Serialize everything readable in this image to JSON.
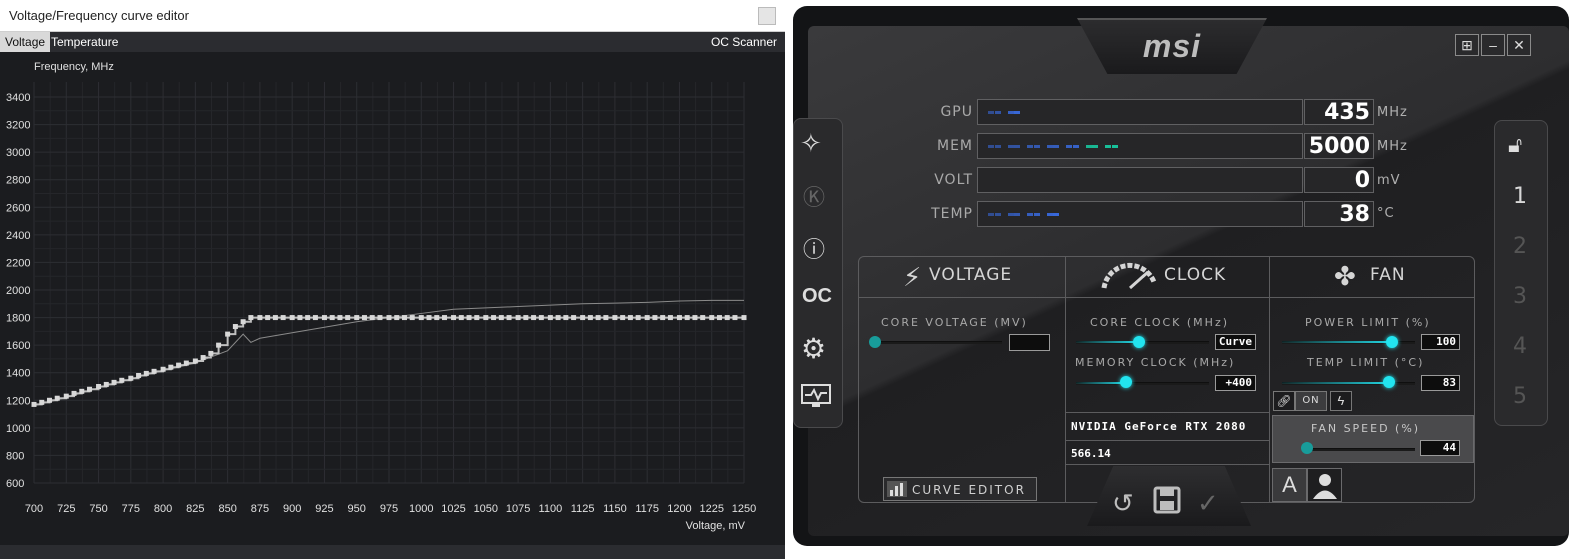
{
  "curve_editor": {
    "title": "Voltage/Frequency curve editor",
    "tabs": [
      "Voltage",
      "Temperature"
    ],
    "oc_scanner": "OC Scanner",
    "chart_data": {
      "type": "line",
      "ylabel": "Frequency, MHz",
      "xlabel": "Voltage, mV",
      "xlim": [
        700,
        1250
      ],
      "ylim": [
        600,
        3400
      ],
      "x_ticks": [
        700,
        725,
        750,
        775,
        800,
        825,
        850,
        875,
        900,
        925,
        950,
        975,
        1000,
        1025,
        1050,
        1075,
        1100,
        1125,
        1150,
        1175,
        1200,
        1225,
        1250
      ],
      "y_ticks": [
        600,
        800,
        1000,
        1200,
        1400,
        1600,
        1800,
        2000,
        2200,
        2400,
        2600,
        2800,
        3000,
        3200,
        3400
      ],
      "grid": true,
      "series": [
        {
          "x": [
            700,
            706,
            712,
            718,
            725,
            731,
            737,
            743,
            750,
            756,
            762,
            768,
            775,
            781,
            787,
            793,
            800,
            806,
            812,
            818,
            825,
            831,
            837,
            843,
            850,
            856,
            862,
            868,
            875,
            881,
            887,
            893,
            900,
            906,
            912,
            918,
            925,
            931,
            937,
            943,
            950,
            956,
            962,
            968,
            975,
            981,
            987,
            993,
            1000,
            1006,
            1012,
            1018,
            1025,
            1031,
            1037,
            1043,
            1050,
            1056,
            1062,
            1068,
            1075,
            1081,
            1087,
            1093,
            1100,
            1106,
            1112,
            1118,
            1125,
            1131,
            1137,
            1143,
            1150,
            1156,
            1162,
            1168,
            1175,
            1181,
            1187,
            1193,
            1200,
            1206,
            1212,
            1218,
            1225,
            1231,
            1237,
            1243,
            1250
          ],
          "y": [
            1170,
            1185,
            1200,
            1215,
            1230,
            1250,
            1265,
            1280,
            1300,
            1315,
            1330,
            1345,
            1360,
            1380,
            1395,
            1410,
            1425,
            1440,
            1455,
            1470,
            1485,
            1510,
            1540,
            1600,
            1680,
            1735,
            1770,
            1800,
            1800,
            1800,
            1800,
            1800,
            1800,
            1800,
            1800,
            1800,
            1800,
            1800,
            1800,
            1800,
            1800,
            1800,
            1800,
            1800,
            1800,
            1800,
            1800,
            1800,
            1800,
            1800,
            1800,
            1800,
            1800,
            1800,
            1800,
            1800,
            1800,
            1800,
            1800,
            1800,
            1800,
            1800,
            1800,
            1800,
            1800,
            1800,
            1800,
            1800,
            1800,
            1800,
            1800,
            1800,
            1800,
            1800,
            1800,
            1800,
            1800,
            1800,
            1800,
            1800,
            1800,
            1800,
            1800,
            1800,
            1800,
            1800,
            1800,
            1800,
            1800
          ]
        },
        {
          "x": [
            700,
            725,
            750,
            775,
            800,
            825,
            850,
            862,
            868,
            875,
            900,
            925,
            950,
            975,
            1000,
            1025,
            1050,
            1075,
            1100,
            1125,
            1150,
            1175,
            1200,
            1225,
            1250
          ],
          "y": [
            1160,
            1220,
            1290,
            1355,
            1415,
            1470,
            1560,
            1680,
            1620,
            1650,
            1690,
            1730,
            1770,
            1800,
            1830,
            1860,
            1870,
            1880,
            1890,
            1900,
            1905,
            1910,
            1920,
            1925,
            1925
          ]
        }
      ]
    }
  },
  "afterburner": {
    "brand": "msi",
    "monitor": [
      {
        "label": "GPU",
        "value": "435",
        "unit": "MHz",
        "fill": 0.17
      },
      {
        "label": "MEM",
        "value": "5000",
        "unit": "MHz",
        "fill": 0.65
      },
      {
        "label": "VOLT",
        "value": "0",
        "unit": "mV",
        "fill": 0
      },
      {
        "label": "TEMP",
        "value": "38",
        "unit": "°C",
        "fill": 0.38
      }
    ],
    "sections": {
      "voltage": "VOLTAGE",
      "clock": "CLOCK",
      "fan": "FAN"
    },
    "core_voltage": {
      "label": "CORE VOLTAGE  (MV)",
      "value": ""
    },
    "core_clock": {
      "label": "CORE CLOCK (MHz)",
      "value": "Curve"
    },
    "memory_clock": {
      "label": "MEMORY CLOCK (MHz)",
      "value": "+400"
    },
    "power_limit": {
      "label": "POWER LIMIT (%)",
      "value": "100"
    },
    "temp_limit": {
      "label": "TEMP LIMIT (°C)",
      "value": "83"
    },
    "link_on": "ON",
    "fan_speed": {
      "label": "FAN SPEED (%)",
      "value": "44"
    },
    "gpu_name": "NVIDIA GeForce RTX 2080",
    "driver_version": "566.14",
    "curve_editor_button": "CURVE EDITOR",
    "profiles": [
      "1",
      "2",
      "3",
      "4",
      "5"
    ],
    "colors": {
      "accent": "#22e4ef",
      "bar_blue": "#3a6ee8",
      "bar_teal": "#17c9a0"
    }
  }
}
